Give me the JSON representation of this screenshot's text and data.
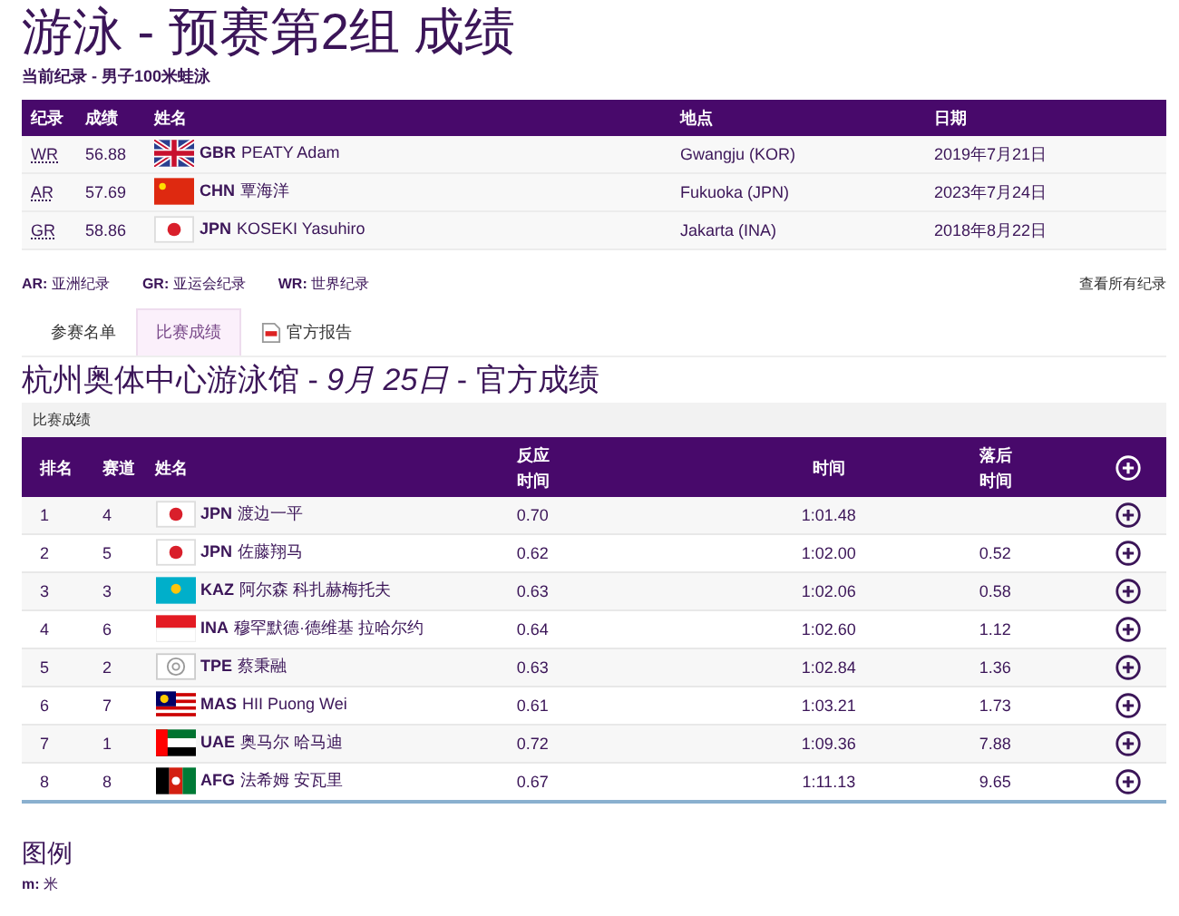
{
  "title": "游泳 - 预赛第2组 成绩",
  "subtitle": "当前纪录 - 男子100米蛙泳",
  "records": {
    "columns": [
      "纪录",
      "成绩",
      "姓名",
      "地点",
      "日期"
    ],
    "rows": [
      {
        "code": "WR",
        "mark": "56.88",
        "flag": {
          "kind": "gb"
        },
        "noc": "GBR",
        "name": "PEATY Adam",
        "place": "Gwangju (KOR)",
        "date": "2019年7月21日"
      },
      {
        "code": "AR",
        "mark": "57.69",
        "flag": {
          "kind": "cn"
        },
        "noc": "CHN",
        "name": "覃海洋",
        "place": "Fukuoka (JPN)",
        "date": "2023年7月24日"
      },
      {
        "code": "GR",
        "mark": "58.86",
        "flag": {
          "kind": "jp"
        },
        "noc": "JPN",
        "name": "KOSEKI Yasuhiro",
        "place": "Jakarta (INA)",
        "date": "2018年8月22日"
      }
    ]
  },
  "record_legend": [
    {
      "abbr": "AR:",
      "text": "亚洲纪录"
    },
    {
      "abbr": "GR:",
      "text": "亚运会纪录"
    },
    {
      "abbr": "WR:",
      "text": "世界纪录"
    }
  ],
  "all_records_link": "查看所有纪录",
  "tabs": [
    {
      "label": "参赛名单",
      "selected": false
    },
    {
      "label": "比赛成绩",
      "selected": true
    },
    {
      "label": "官方报告",
      "selected": false,
      "kind": "pdf"
    }
  ],
  "heading": {
    "venue": "杭州奥体中心游泳馆 - ",
    "date": "9月 25日",
    "suffix": " - 官方成绩"
  },
  "section_label": "比赛成绩",
  "results": {
    "columns": {
      "rank": "排名",
      "lane": "赛道",
      "name": "姓名",
      "reaction": [
        "反应",
        "时间"
      ],
      "time": "时间",
      "behind": [
        "落后",
        "时间"
      ]
    },
    "rows": [
      {
        "rank": "1",
        "lane": "4",
        "flag": {
          "kind": "jp"
        },
        "noc": "JPN",
        "name": "渡边一平",
        "reaction": "0.70",
        "time": "1:01.48"
      },
      {
        "rank": "2",
        "lane": "5",
        "flag": {
          "kind": "jp"
        },
        "noc": "JPN",
        "name": "佐藤翔马",
        "reaction": "0.62",
        "time": "1:02.00",
        "behind": "0.52"
      },
      {
        "rank": "3",
        "lane": "3",
        "flag": {
          "kind": "kz"
        },
        "noc": "KAZ",
        "name": "阿尔森 科扎赫梅托夫",
        "reaction": "0.63",
        "time": "1:02.06",
        "behind": "0.58"
      },
      {
        "rank": "4",
        "lane": "6",
        "flag": {
          "kind": "id"
        },
        "noc": "INA",
        "name": "穆罕默德·德维基 拉哈尔约",
        "reaction": "0.64",
        "time": "1:02.60",
        "behind": "1.12"
      },
      {
        "rank": "5",
        "lane": "2",
        "flag": {
          "kind": "tpe"
        },
        "noc": "TPE",
        "name": "蔡秉融",
        "reaction": "0.63",
        "time": "1:02.84",
        "behind": "1.36"
      },
      {
        "rank": "6",
        "lane": "7",
        "flag": {
          "kind": "my"
        },
        "noc": "MAS",
        "name": "HII Puong Wei",
        "reaction": "0.61",
        "time": "1:03.21",
        "behind": "1.73"
      },
      {
        "rank": "7",
        "lane": "1",
        "flag": {
          "kind": "ae"
        },
        "noc": "UAE",
        "name": "奥马尔 哈马迪",
        "reaction": "0.72",
        "time": "1:09.36",
        "behind": "7.88"
      },
      {
        "rank": "8",
        "lane": "8",
        "flag": {
          "kind": "af"
        },
        "noc": "AFG",
        "name": "法希姆 安瓦里",
        "reaction": "0.67",
        "time": "1:11.13",
        "behind": "9.65"
      }
    ]
  },
  "legend": {
    "title": "图例",
    "items": [
      {
        "abbr": "m:",
        "text": "米"
      }
    ]
  }
}
